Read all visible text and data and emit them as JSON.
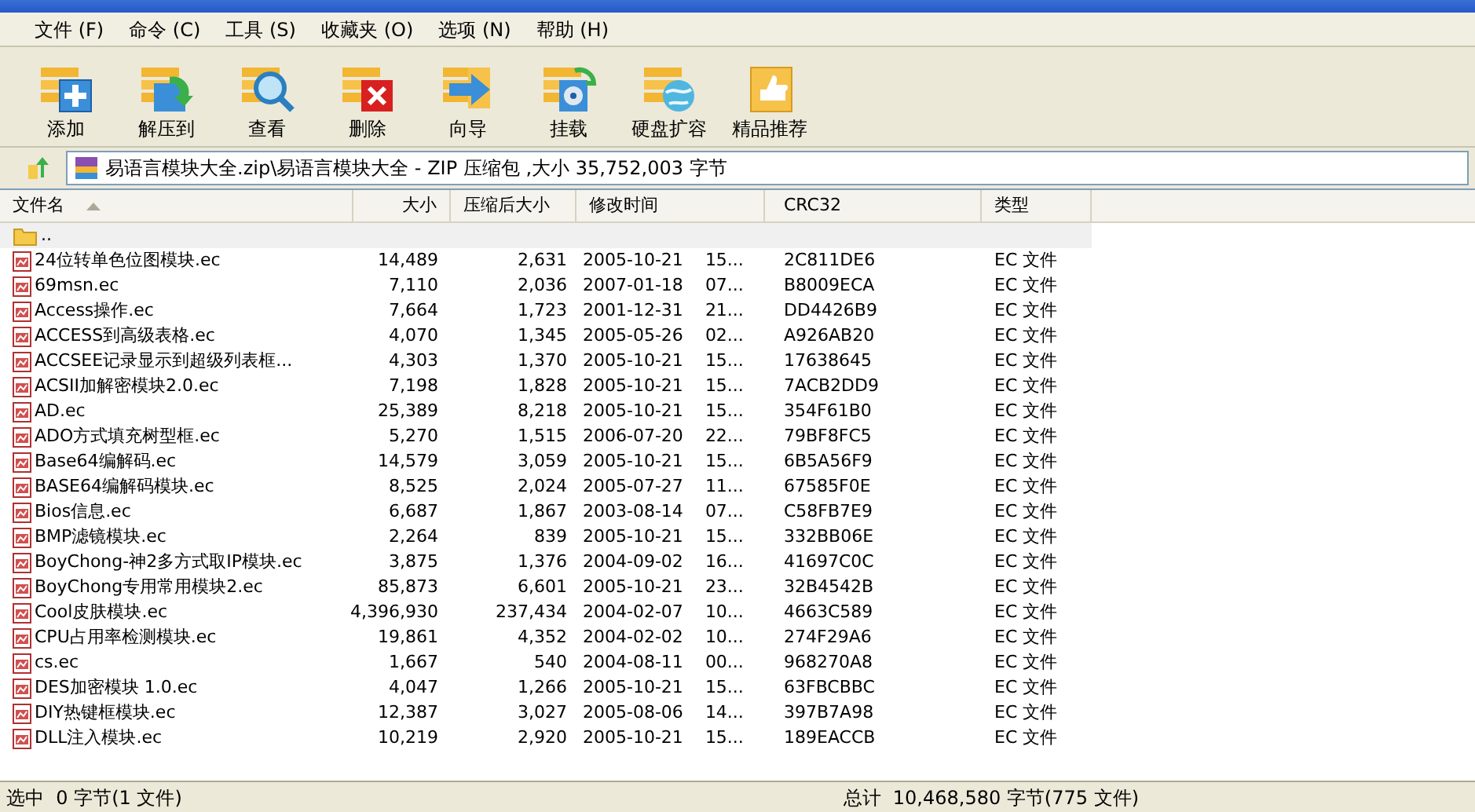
{
  "menu": [
    {
      "label": "文件",
      "key": "(F)"
    },
    {
      "label": "命令",
      "key": "(C)"
    },
    {
      "label": "工具",
      "key": "(S)"
    },
    {
      "label": "收藏夹",
      "key": "(O)"
    },
    {
      "label": "选项",
      "key": "(N)"
    },
    {
      "label": "帮助",
      "key": "(H)"
    }
  ],
  "toolbar": [
    {
      "label": "添加",
      "kind": "add"
    },
    {
      "label": "解压到",
      "kind": "extract"
    },
    {
      "label": "查看",
      "kind": "view"
    },
    {
      "label": "删除",
      "kind": "delete"
    },
    {
      "label": "向导",
      "kind": "wizard"
    },
    {
      "label": "挂载",
      "kind": "mount"
    },
    {
      "label": "硬盘扩容",
      "kind": "disk"
    },
    {
      "label": "精品推荐",
      "kind": "recommend"
    }
  ],
  "address": {
    "text": "易语言模块大全.zip\\易语言模块大全 - ZIP 压缩包 ,大小 35,752,003 字节"
  },
  "table": {
    "columns": [
      {
        "label": "文件名",
        "sorted": true
      },
      {
        "label": "大小",
        "sorted": false
      },
      {
        "label": "压缩后大小",
        "sorted": false
      },
      {
        "label": "修改时间",
        "sorted": false
      },
      {
        "label": "CRC32",
        "sorted": false
      },
      {
        "label": "类型",
        "sorted": false
      }
    ],
    "rows": [
      {
        "kind": "folder",
        "name": "..",
        "selected": true
      },
      {
        "kind": "file",
        "name": "24位转单色位图模块.ec",
        "size": "14,489",
        "packed": "2,631",
        "date": "2005-10-21",
        "time": "15...",
        "crc": "2C811DE6",
        "type": "EC 文件",
        "selected": false
      },
      {
        "kind": "file",
        "name": "69msn.ec",
        "size": "7,110",
        "packed": "2,036",
        "date": "2007-01-18",
        "time": "07...",
        "crc": "B8009ECA",
        "type": "EC 文件",
        "selected": false
      },
      {
        "kind": "file",
        "name": "Access操作.ec",
        "size": "7,664",
        "packed": "1,723",
        "date": "2001-12-31",
        "time": "21...",
        "crc": "DD4426B9",
        "type": "EC 文件",
        "selected": false
      },
      {
        "kind": "file",
        "name": "ACCESS到高级表格.ec",
        "size": "4,070",
        "packed": "1,345",
        "date": "2005-05-26",
        "time": "02...",
        "crc": "A926AB20",
        "type": "EC 文件",
        "selected": false
      },
      {
        "kind": "file",
        "name": "ACCSEE记录显示到超级列表框...",
        "size": "4,303",
        "packed": "1,370",
        "date": "2005-10-21",
        "time": "15...",
        "crc": "17638645",
        "type": "EC 文件",
        "selected": false
      },
      {
        "kind": "file",
        "name": "ACSII加解密模块2.0.ec",
        "size": "7,198",
        "packed": "1,828",
        "date": "2005-10-21",
        "time": "15...",
        "crc": "7ACB2DD9",
        "type": "EC 文件",
        "selected": false
      },
      {
        "kind": "file",
        "name": "AD.ec",
        "size": "25,389",
        "packed": "8,218",
        "date": "2005-10-21",
        "time": "15...",
        "crc": "354F61B0",
        "type": "EC 文件",
        "selected": false
      },
      {
        "kind": "file",
        "name": "ADO方式填充树型框.ec",
        "size": "5,270",
        "packed": "1,515",
        "date": "2006-07-20",
        "time": "22...",
        "crc": "79BF8FC5",
        "type": "EC 文件",
        "selected": false
      },
      {
        "kind": "file",
        "name": "Base64编解码.ec",
        "size": "14,579",
        "packed": "3,059",
        "date": "2005-10-21",
        "time": "15...",
        "crc": "6B5A56F9",
        "type": "EC 文件",
        "selected": false
      },
      {
        "kind": "file",
        "name": "BASE64编解码模块.ec",
        "size": "8,525",
        "packed": "2,024",
        "date": "2005-07-27",
        "time": "11...",
        "crc": "67585F0E",
        "type": "EC 文件",
        "selected": false
      },
      {
        "kind": "file",
        "name": "Bios信息.ec",
        "size": "6,687",
        "packed": "1,867",
        "date": "2003-08-14",
        "time": "07...",
        "crc": "C58FB7E9",
        "type": "EC 文件",
        "selected": false
      },
      {
        "kind": "file",
        "name": "BMP滤镜模块.ec",
        "size": "2,264",
        "packed": "839",
        "date": "2005-10-21",
        "time": "15...",
        "crc": "332BB06E",
        "type": "EC 文件",
        "selected": false
      },
      {
        "kind": "file",
        "name": "BoyChong-神2多方式取IP模块.ec",
        "size": "3,875",
        "packed": "1,376",
        "date": "2004-09-02",
        "time": "16...",
        "crc": "41697C0C",
        "type": "EC 文件",
        "selected": false
      },
      {
        "kind": "file",
        "name": "BoyChong专用常用模块2.ec",
        "size": "85,873",
        "packed": "6,601",
        "date": "2005-10-21",
        "time": "23...",
        "crc": "32B4542B",
        "type": "EC 文件",
        "selected": false
      },
      {
        "kind": "file",
        "name": "Cool皮肤模块.ec",
        "size": "4,396,930",
        "packed": "237,434",
        "date": "2004-02-07",
        "time": "10...",
        "crc": "4663C589",
        "type": "EC 文件",
        "selected": false
      },
      {
        "kind": "file",
        "name": "CPU占用率检测模块.ec",
        "size": "19,861",
        "packed": "4,352",
        "date": "2004-02-02",
        "time": "10...",
        "crc": "274F29A6",
        "type": "EC 文件",
        "selected": false
      },
      {
        "kind": "file",
        "name": "cs.ec",
        "size": "1,667",
        "packed": "540",
        "date": "2004-08-11",
        "time": "00...",
        "crc": "968270A8",
        "type": "EC 文件",
        "selected": false
      },
      {
        "kind": "file",
        "name": "DES加密模块 1.0.ec",
        "size": "4,047",
        "packed": "1,266",
        "date": "2005-10-21",
        "time": "15...",
        "crc": "63FBCBBC",
        "type": "EC 文件",
        "selected": false
      },
      {
        "kind": "file",
        "name": "DIY热键框模块.ec",
        "size": "12,387",
        "packed": "3,027",
        "date": "2005-08-06",
        "time": "14...",
        "crc": "397B7A98",
        "type": "EC 文件",
        "selected": false
      },
      {
        "kind": "file",
        "name": "DLL注入模块.ec",
        "size": "10,219",
        "packed": "2,920",
        "date": "2005-10-21",
        "time": "15...",
        "crc": "189EACCB",
        "type": "EC 文件",
        "selected": false
      }
    ]
  },
  "status": {
    "selected": "选中  0 字节(1 文件)",
    "total": "总计  10,468,580 字节(775 文件)"
  }
}
